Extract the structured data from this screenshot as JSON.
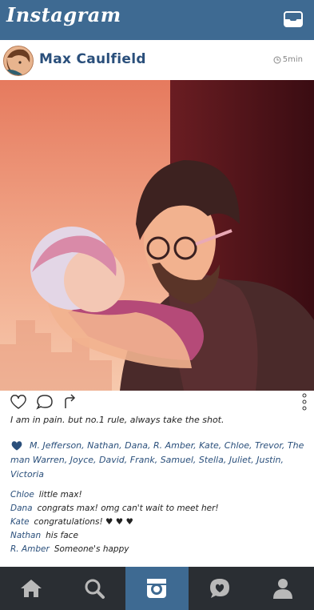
{
  "app": {
    "title": "Instagram"
  },
  "post": {
    "username": "Max Caulfield",
    "time": "5min",
    "caption": "I am in pain. but no.1 rule, always take the shot.",
    "likes": "M. Jefferson, Nathan, Dana, R. Amber, Kate, Chloe, Trevor, The man Warren, Joyce, David, Frank, Samuel, Stella, Juliet, Justin, Victoria",
    "comments": [
      {
        "author": "Chloe",
        "text": "little max!"
      },
      {
        "author": "Dana",
        "text": "congrats max! omg can't wait to meet her!"
      },
      {
        "author": "Kate",
        "text": "congratulations! ♥ ♥ ♥"
      },
      {
        "author": "Nathan",
        "text": "his face"
      },
      {
        "author": "R. Amber",
        "text": "Someone's happy"
      }
    ]
  },
  "icons": {
    "inbox": "inbox-icon",
    "clock": "clock-icon",
    "heart": "heart-icon",
    "comment": "comment-icon",
    "share": "share-icon",
    "more": "more-dots-icon",
    "home": "home-icon",
    "search": "search-icon",
    "camera": "camera-icon",
    "activity": "activity-icon",
    "profile": "profile-icon"
  },
  "colors": {
    "topbar": "#3e6a92",
    "accent": "#2a4f7b",
    "nav": "#2a2e33"
  }
}
